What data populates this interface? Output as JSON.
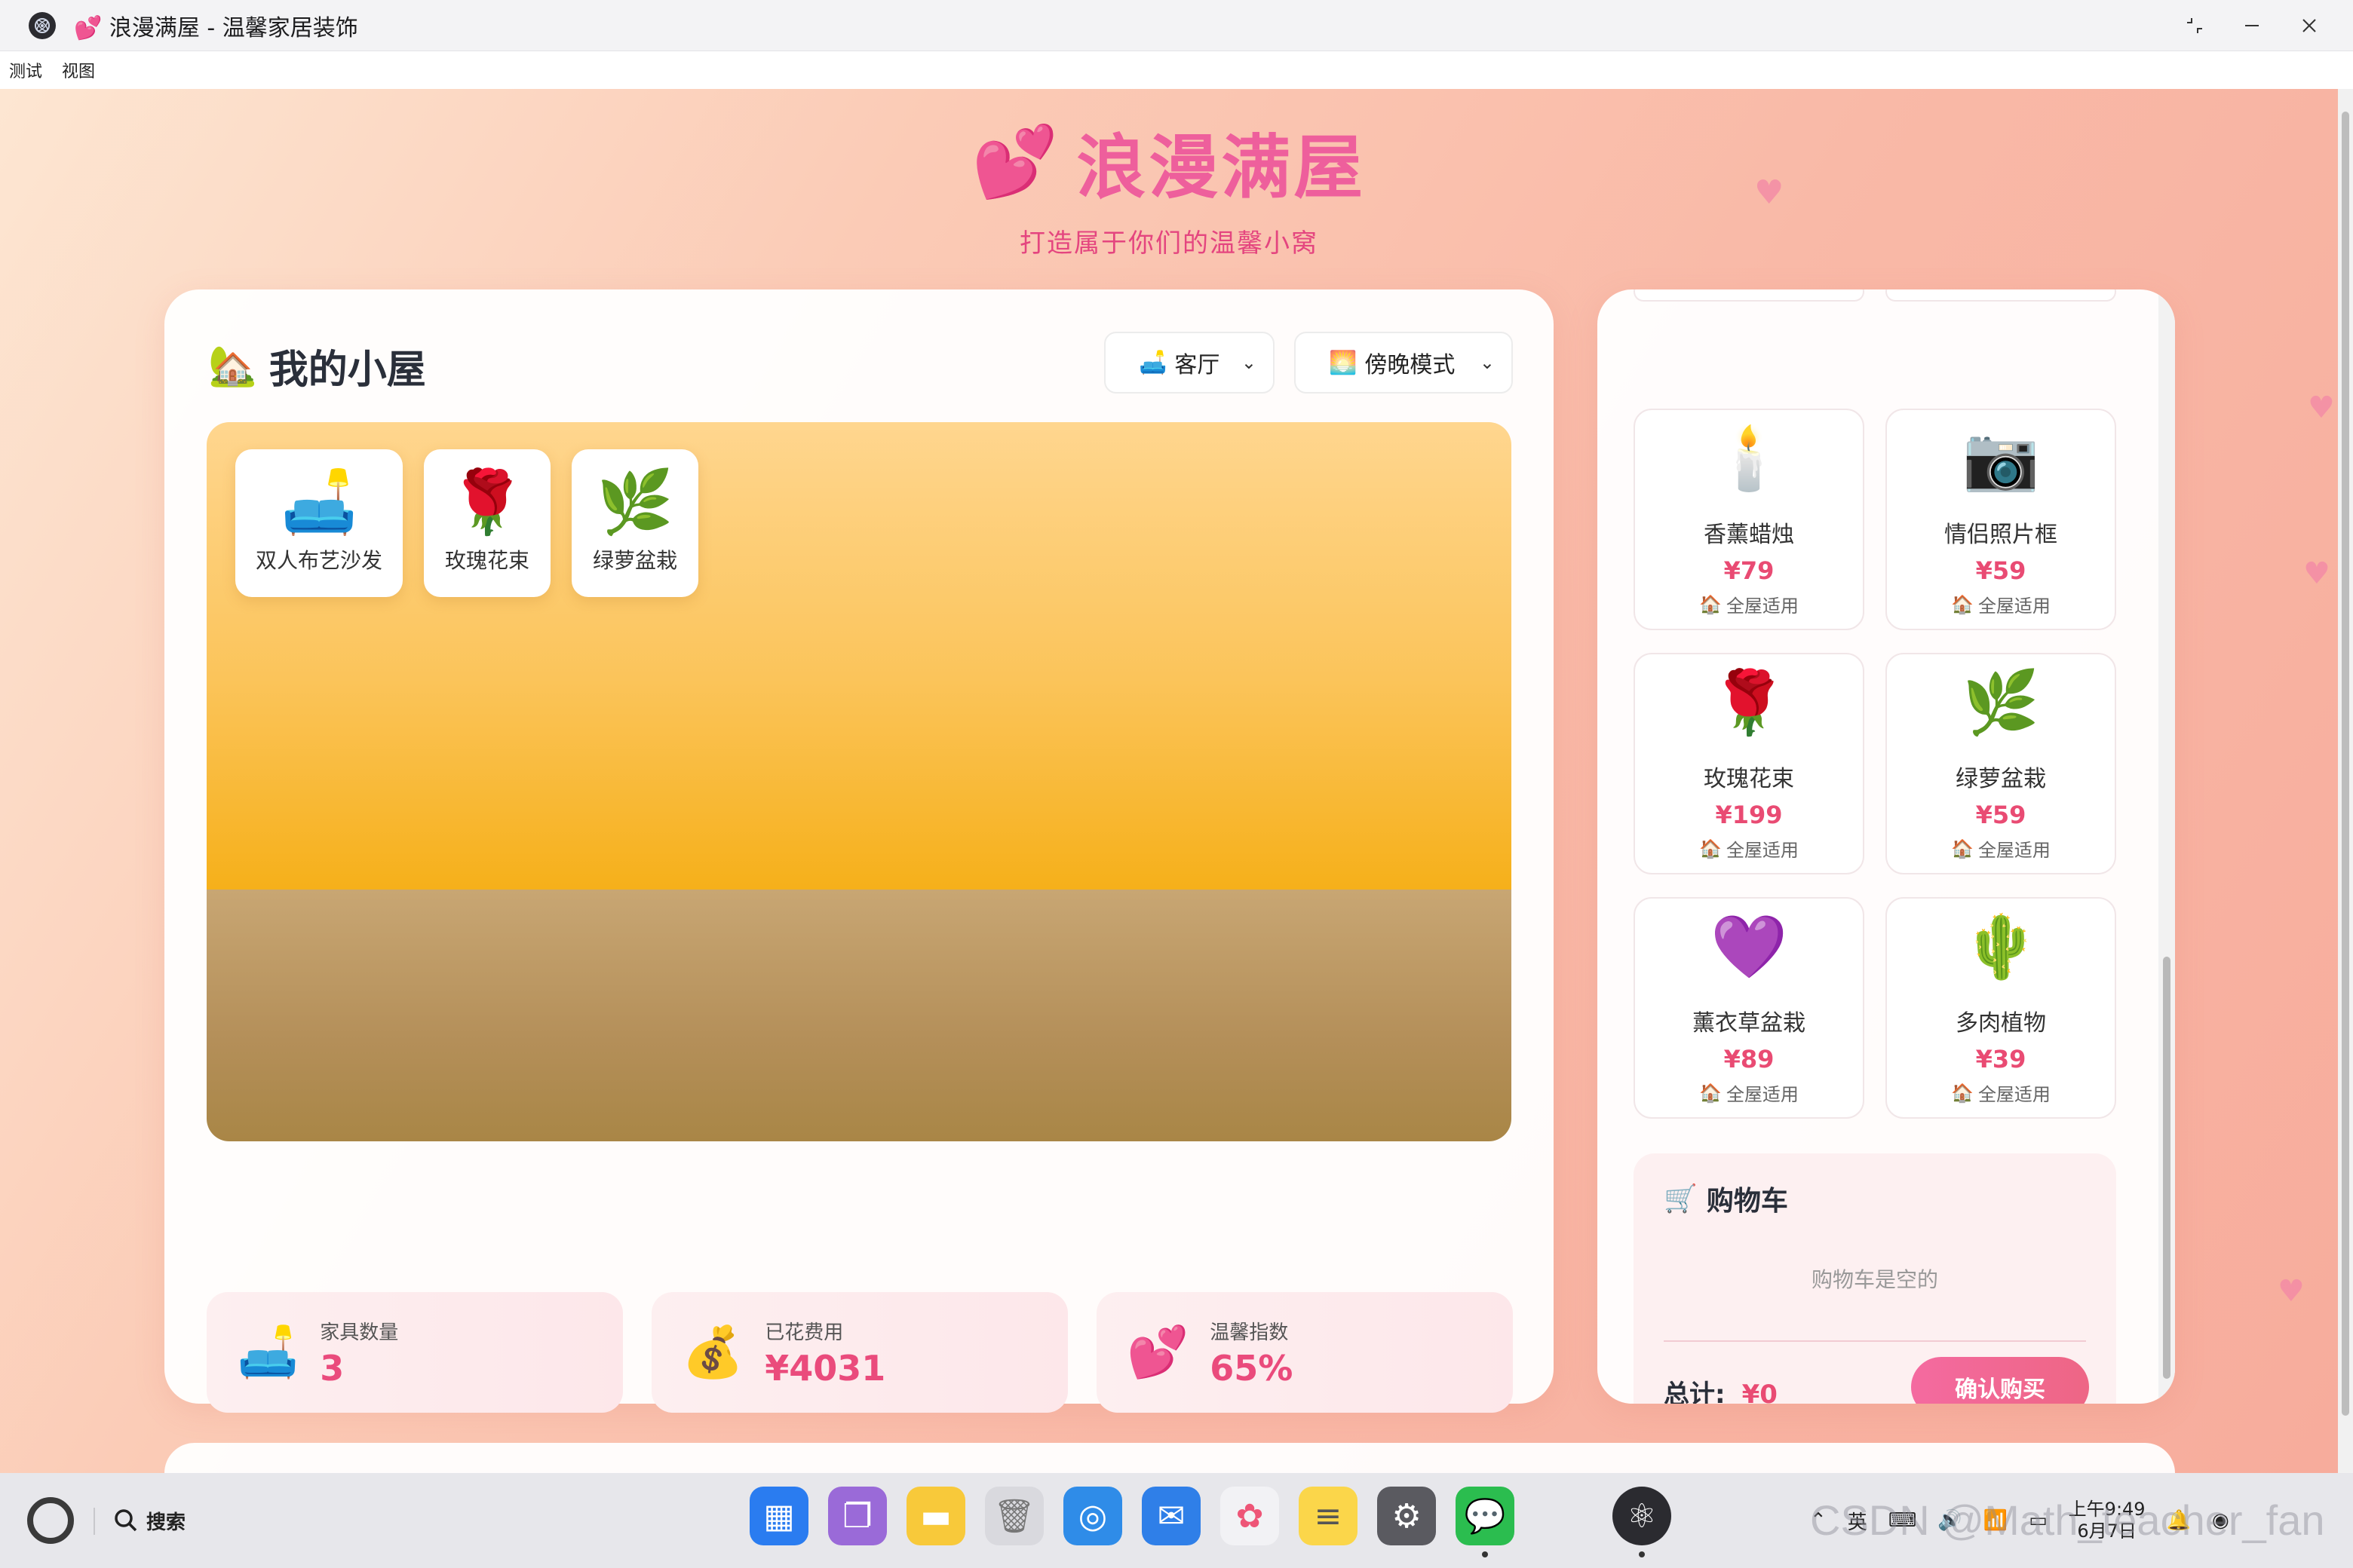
{
  "window": {
    "title": "💕 浪漫满屋 - 温馨家居装饰"
  },
  "menu": {
    "items": [
      "测试",
      "视图"
    ]
  },
  "brand": {
    "title": "浪漫满屋",
    "emoji": "💕",
    "subtitle": "打造属于你们的温馨小窝"
  },
  "room": {
    "title": "我的小屋",
    "title_emoji": "🏡",
    "room_select": {
      "emoji": "🛋️",
      "value": "客厅"
    },
    "mode_select": {
      "emoji": "🌅",
      "value": "傍晚模式"
    },
    "placed_items": [
      {
        "emoji": "🛋️",
        "label": "双人布艺沙发"
      },
      {
        "emoji": "🌹",
        "label": "玫瑰花束"
      },
      {
        "emoji": "🌿",
        "label": "绿萝盆栽"
      }
    ],
    "stats": [
      {
        "emoji": "🛋️",
        "label": "家具数量",
        "value": "3"
      },
      {
        "emoji": "💰",
        "label": "已花费用",
        "value": "¥4031"
      },
      {
        "emoji": "💕",
        "label": "温馨指数",
        "value": "65%"
      }
    ]
  },
  "shop": {
    "items": [
      {
        "emoji": "🕯️",
        "name": "香薰蜡烛",
        "price": "¥79",
        "tag": "全屋适用"
      },
      {
        "emoji": "📷",
        "name": "情侣照片框",
        "price": "¥59",
        "tag": "全屋适用"
      },
      {
        "emoji": "🌹",
        "name": "玫瑰花束",
        "price": "¥199",
        "tag": "全屋适用"
      },
      {
        "emoji": "🌿",
        "name": "绿萝盆栽",
        "price": "¥59",
        "tag": "全屋适用"
      },
      {
        "emoji": "💜",
        "name": "薰衣草盆栽",
        "price": "¥89",
        "tag": "全屋适用"
      },
      {
        "emoji": "🌵",
        "name": "多肉植物",
        "price": "¥39",
        "tag": "全屋适用"
      }
    ],
    "tag_emoji": "🏠",
    "cart": {
      "emoji": "🛒",
      "title": "购物车",
      "empty_text": "购物车是空的",
      "total_label": "总计:",
      "total_value": "¥0",
      "buy_label": "确认购买"
    }
  },
  "taskbar": {
    "search_label": "搜索",
    "clock_time": "上午9:49",
    "clock_date": "6月7日",
    "ime_label": "英"
  },
  "watermark": "CSDN @Math_teacher_fan"
}
